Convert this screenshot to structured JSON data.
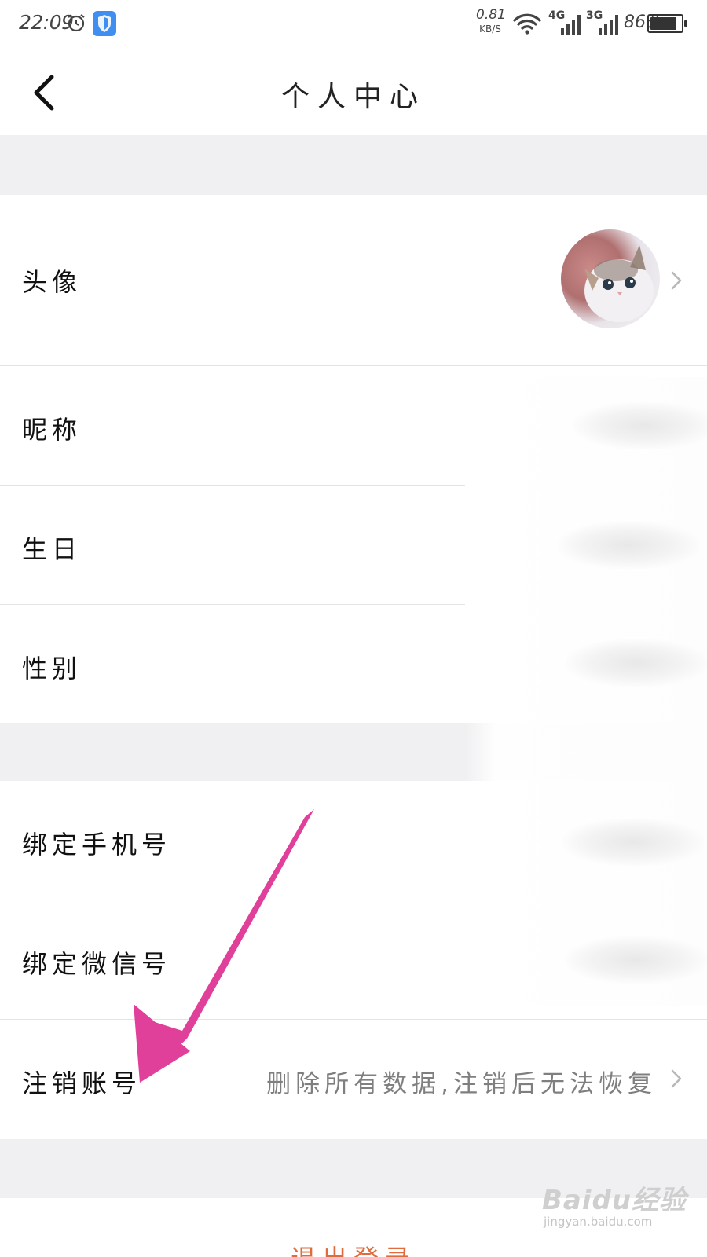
{
  "status_bar": {
    "time": "22:09",
    "net_speed_value": "0.81",
    "net_speed_unit": "KB/S",
    "network1": "4G",
    "network2": "3G",
    "battery_pct": "86%",
    "battery_level": 0.86
  },
  "header": {
    "title": "个人中心"
  },
  "rows": {
    "avatar": {
      "label": "头像"
    },
    "nickname": {
      "label": "昵称"
    },
    "birthday": {
      "label": "生日"
    },
    "gender": {
      "label": "性别"
    },
    "phone": {
      "label": "绑定手机号"
    },
    "wechat": {
      "label": "绑定微信号"
    },
    "delete_account": {
      "label": "注销账号",
      "hint": "删除所有数据,注销后无法恢复"
    }
  },
  "logout": {
    "label": "退出登录"
  },
  "watermark": {
    "brand": "Baidu经验",
    "url": "jingyan.baidu.com"
  },
  "colors": {
    "accent_logout": "#e06b3c",
    "arrow_annotation": "#e0409a",
    "section_gap": "#f0f0f2"
  }
}
